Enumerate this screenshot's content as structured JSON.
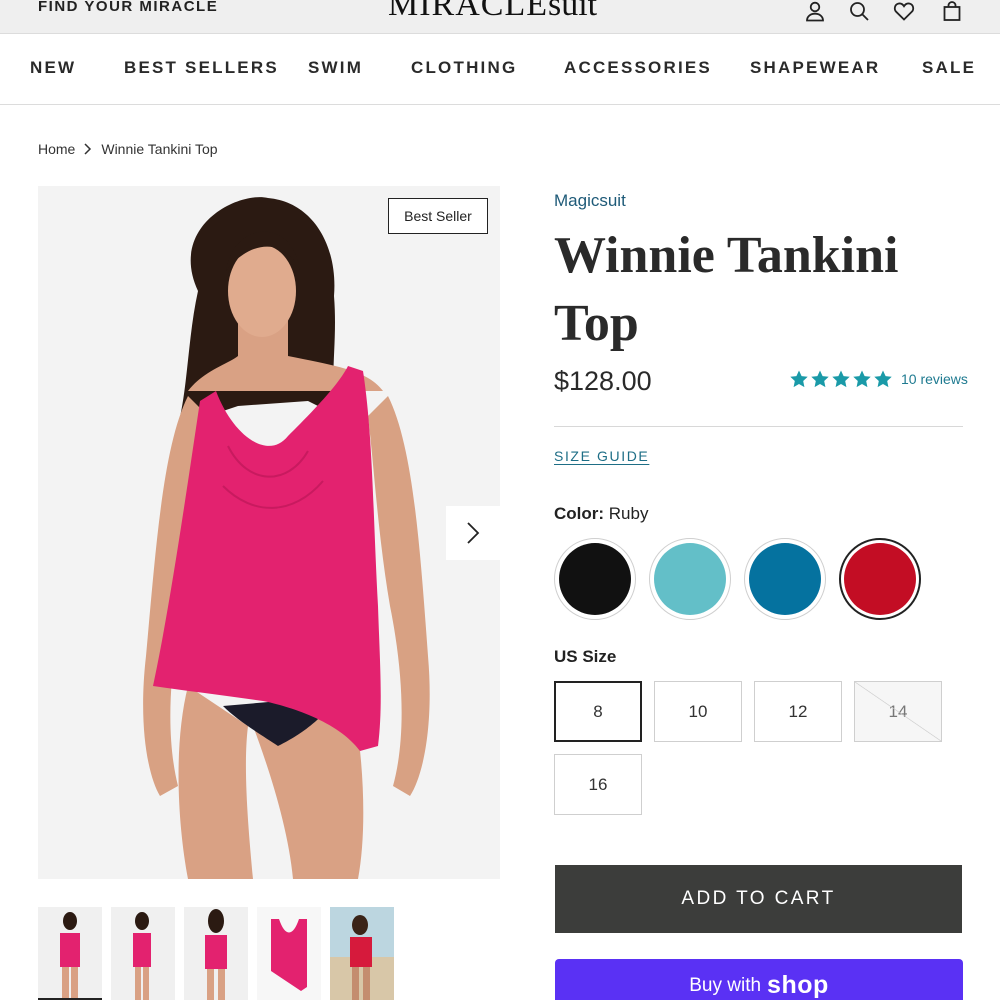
{
  "header": {
    "find_link": "FIND YOUR MIRACLE",
    "logo_bold": "MIRACLE",
    "logo_thin": "suit",
    "icons": [
      "account-icon",
      "search-icon",
      "heart-icon",
      "bag-icon"
    ]
  },
  "nav": {
    "items": [
      "NEW",
      "BEST SELLERS",
      "SWIM",
      "CLOTHING",
      "ACCESSORIES",
      "SHAPEWEAR",
      "SALE"
    ]
  },
  "breadcrumb": {
    "home": "Home",
    "current": "Winnie Tankini Top"
  },
  "gallery": {
    "badge": "Best Seller",
    "thumbnail_count": 5
  },
  "product": {
    "brand": "Magicsuit",
    "title": "Winnie Tankini Top",
    "price": "$128.00",
    "rating": 5,
    "reviews": "10 reviews",
    "size_guide": "SIZE GUIDE",
    "color_label": "Color:",
    "color_value": "Ruby",
    "colors": [
      {
        "name": "Black",
        "hex": "#111111"
      },
      {
        "name": "Aqua",
        "hex": "#63bfc8"
      },
      {
        "name": "Blue",
        "hex": "#05729f"
      },
      {
        "name": "Ruby",
        "hex": "#c30d24",
        "selected": true
      }
    ],
    "size_label": "US Size",
    "sizes": [
      {
        "label": "8",
        "selected": true
      },
      {
        "label": "10"
      },
      {
        "label": "12"
      },
      {
        "label": "14",
        "sold_out": true
      },
      {
        "label": "16"
      }
    ],
    "add_to_cart": "ADD TO CART",
    "buy_with": "Buy with",
    "shop": "shop"
  },
  "colors": {
    "accent_teal": "#1e7a90",
    "star": "#1a9aa8",
    "cart_button": "#3c3d3b",
    "shop_button": "#5a31f4",
    "swimsuit": "#e3226f"
  }
}
